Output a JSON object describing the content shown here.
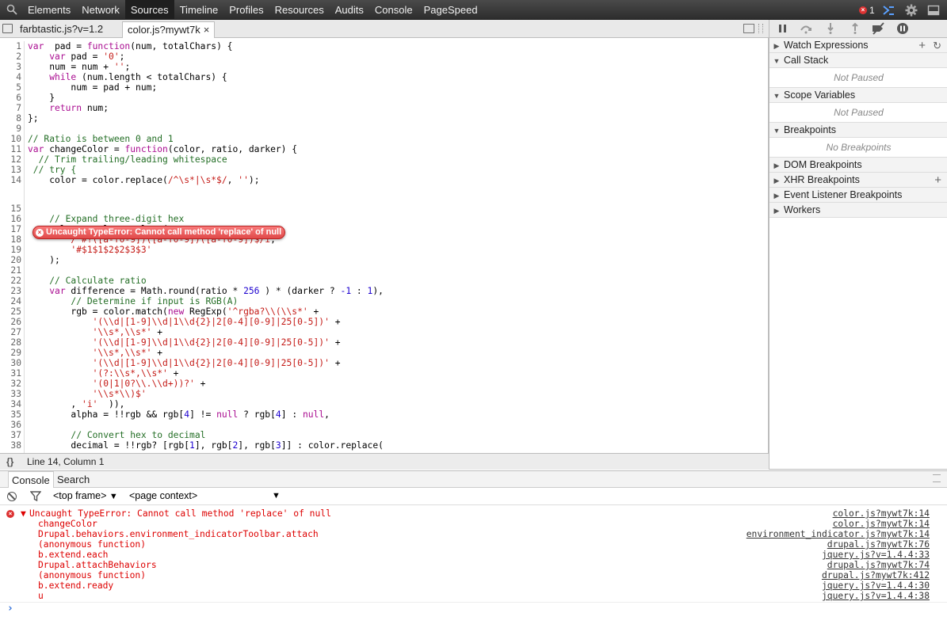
{
  "toolbar": {
    "tabs": [
      "Elements",
      "Network",
      "Sources",
      "Timeline",
      "Profiles",
      "Resources",
      "Audits",
      "Console",
      "PageSpeed"
    ],
    "active_tab": "Sources",
    "error_count": "1",
    "icons": [
      "search-icon",
      "error-icon",
      "drawer-toggle-icon",
      "settings-gear-icon",
      "dock-icon"
    ]
  },
  "file_tabs": {
    "tabs": [
      "farbtastic.js?v=1.2",
      "color.js?mywt7k"
    ],
    "active": "color.js?mywt7k",
    "close_glyph": "×"
  },
  "editor": {
    "lines": [
      {
        "n": "1",
        "segs": [
          [
            "kw",
            "var"
          ],
          [
            "",
            "  pad = "
          ],
          [
            "kw",
            "function"
          ],
          [
            "",
            "(num, totalChars) {"
          ]
        ]
      },
      {
        "n": "2",
        "segs": [
          [
            "",
            "    "
          ],
          [
            "kw",
            "var"
          ],
          [
            "",
            " pad = "
          ],
          [
            "str",
            "'0'"
          ],
          [
            "",
            ";"
          ]
        ]
      },
      {
        "n": "3",
        "segs": [
          [
            "",
            "    num = num + "
          ],
          [
            "str",
            "''"
          ],
          [
            "",
            ";"
          ]
        ]
      },
      {
        "n": "4",
        "segs": [
          [
            "",
            "    "
          ],
          [
            "kw",
            "while"
          ],
          [
            "",
            " (num.length < totalChars) {"
          ]
        ]
      },
      {
        "n": "5",
        "segs": [
          [
            "",
            "        num = pad + num;"
          ]
        ]
      },
      {
        "n": "6",
        "segs": [
          [
            "",
            "    }"
          ]
        ]
      },
      {
        "n": "7",
        "segs": [
          [
            "",
            "    "
          ],
          [
            "kw",
            "return"
          ],
          [
            "",
            " num;"
          ]
        ]
      },
      {
        "n": "8",
        "segs": [
          [
            "",
            "};"
          ]
        ]
      },
      {
        "n": "9",
        "segs": []
      },
      {
        "n": "10",
        "segs": [
          [
            "cmt",
            "// Ratio is between 0 and 1"
          ]
        ]
      },
      {
        "n": "11",
        "segs": [
          [
            "kw",
            "var"
          ],
          [
            "",
            " changeColor = "
          ],
          [
            "kw",
            "function"
          ],
          [
            "",
            "(color, ratio, darker) {"
          ]
        ]
      },
      {
        "n": "12",
        "segs": [
          [
            "",
            "  "
          ],
          [
            "cmt",
            "// Trim trailing/leading whitespace"
          ]
        ]
      },
      {
        "n": "13",
        "segs": [
          [
            "",
            ""
          ],
          [
            "cmt",
            " // try {"
          ]
        ]
      },
      {
        "n": "14",
        "segs": [
          [
            "",
            "    color = color.replace("
          ],
          [
            "str",
            "/^\\s*|\\s*$/"
          ],
          [
            "",
            ", "
          ],
          [
            "str",
            "''"
          ],
          [
            "",
            ");"
          ]
        ]
      },
      {
        "n": "15",
        "segs": []
      },
      {
        "n": "16",
        "segs": [
          [
            "",
            "    "
          ],
          [
            "cmt",
            "// Expand three-digit hex"
          ]
        ]
      },
      {
        "n": "17",
        "segs": [
          [
            "",
            "    color = color.replace("
          ]
        ]
      },
      {
        "n": "18",
        "segs": [
          [
            "",
            "        "
          ],
          [
            "str",
            "/^#?([a-f0-9])([a-f0-9])([a-f0-9])$/i"
          ],
          [
            "",
            ","
          ]
        ]
      },
      {
        "n": "19",
        "segs": [
          [
            "",
            "        "
          ],
          [
            "str",
            "'#$1$1$2$2$3$3'"
          ]
        ]
      },
      {
        "n": "20",
        "segs": [
          [
            "",
            "    );"
          ]
        ]
      },
      {
        "n": "21",
        "segs": []
      },
      {
        "n": "22",
        "segs": [
          [
            "",
            "    "
          ],
          [
            "cmt",
            "// Calculate ratio"
          ]
        ]
      },
      {
        "n": "23",
        "segs": [
          [
            "",
            "    "
          ],
          [
            "kw",
            "var"
          ],
          [
            "",
            " difference = Math.round(ratio * "
          ],
          [
            "num",
            "256"
          ],
          [
            "",
            " ) * (darker ? "
          ],
          [
            "num",
            "-1"
          ],
          [
            "",
            " : "
          ],
          [
            "num",
            "1"
          ],
          [
            "",
            "),"
          ]
        ]
      },
      {
        "n": "24",
        "segs": [
          [
            "",
            "        "
          ],
          [
            "cmt",
            "// Determine if input is RGB(A)"
          ]
        ]
      },
      {
        "n": "25",
        "segs": [
          [
            "",
            "        rgb = color.match("
          ],
          [
            "kw",
            "new"
          ],
          [
            "",
            " RegExp("
          ],
          [
            "str",
            "'^rgba?\\\\(\\\\s*'"
          ],
          [
            "",
            " +"
          ]
        ]
      },
      {
        "n": "26",
        "segs": [
          [
            "",
            "            "
          ],
          [
            "str",
            "'(\\\\d|[1-9]\\\\d|1\\\\d{2}|2[0-4][0-9]|25[0-5])'"
          ],
          [
            "",
            " +"
          ]
        ]
      },
      {
        "n": "27",
        "segs": [
          [
            "",
            "            "
          ],
          [
            "str",
            "'\\\\s*,\\\\s*'"
          ],
          [
            "",
            " +"
          ]
        ]
      },
      {
        "n": "28",
        "segs": [
          [
            "",
            "            "
          ],
          [
            "str",
            "'(\\\\d|[1-9]\\\\d|1\\\\d{2}|2[0-4][0-9]|25[0-5])'"
          ],
          [
            "",
            " +"
          ]
        ]
      },
      {
        "n": "29",
        "segs": [
          [
            "",
            "            "
          ],
          [
            "str",
            "'\\\\s*,\\\\s*'"
          ],
          [
            "",
            " +"
          ]
        ]
      },
      {
        "n": "30",
        "segs": [
          [
            "",
            "            "
          ],
          [
            "str",
            "'(\\\\d|[1-9]\\\\d|1\\\\d{2}|2[0-4][0-9]|25[0-5])'"
          ],
          [
            "",
            " +"
          ]
        ]
      },
      {
        "n": "31",
        "segs": [
          [
            "",
            "            "
          ],
          [
            "str",
            "'(?:\\\\s*,\\\\s*'"
          ],
          [
            "",
            " +"
          ]
        ]
      },
      {
        "n": "32",
        "segs": [
          [
            "",
            "            "
          ],
          [
            "str",
            "'(0|1|0?\\\\.\\\\d+))?'"
          ],
          [
            "",
            " +"
          ]
        ]
      },
      {
        "n": "33",
        "segs": [
          [
            "",
            "            "
          ],
          [
            "str",
            "'\\\\s*\\\\)$'"
          ]
        ]
      },
      {
        "n": "34",
        "segs": [
          [
            "",
            "        , "
          ],
          [
            "str",
            "'i'"
          ],
          [
            "",
            "  )),"
          ]
        ]
      },
      {
        "n": "35",
        "segs": [
          [
            "",
            "        alpha = !!rgb && rgb["
          ],
          [
            "num",
            "4"
          ],
          [
            "",
            "] != "
          ],
          [
            "kw",
            "null"
          ],
          [
            "",
            " ? rgb["
          ],
          [
            "num",
            "4"
          ],
          [
            "",
            "] : "
          ],
          [
            "kw",
            "null"
          ],
          [
            "",
            ","
          ]
        ]
      },
      {
        "n": "36",
        "segs": []
      },
      {
        "n": "37",
        "segs": [
          [
            "",
            "        "
          ],
          [
            "cmt",
            "// Convert hex to decimal"
          ]
        ]
      },
      {
        "n": "38",
        "segs": [
          [
            "",
            "        decimal = !!rgb? [rgb["
          ],
          [
            "num",
            "1"
          ],
          [
            "",
            "], rgb["
          ],
          [
            "num",
            "2"
          ],
          [
            "",
            "], rgb["
          ],
          [
            "num",
            "3"
          ],
          [
            "",
            "]] : color.replace("
          ]
        ]
      }
    ],
    "error_message": "Uncaught TypeError: Cannot call method 'replace' of null"
  },
  "status_bar": {
    "braces": "{}",
    "cursor_position": "Line 14, Column 1"
  },
  "sidebar": {
    "sections": [
      {
        "title": "Watch Expressions",
        "expanded": false
      },
      {
        "title": "Call Stack",
        "expanded": true,
        "info": "Not Paused"
      },
      {
        "title": "Scope Variables",
        "expanded": true,
        "info": "Not Paused"
      },
      {
        "title": "Breakpoints",
        "expanded": true,
        "info": "No Breakpoints"
      },
      {
        "title": "DOM Breakpoints",
        "expanded": false
      },
      {
        "title": "XHR Breakpoints",
        "expanded": false
      },
      {
        "title": "Event Listener Breakpoints",
        "expanded": false
      },
      {
        "title": "Workers",
        "expanded": false
      }
    ],
    "plus_glyph": "+",
    "refresh_glyph": "↻"
  },
  "drawer": {
    "tabs": [
      "Console",
      "Search"
    ],
    "active": "Console",
    "frame_select": "<top frame>",
    "context_select": "<page context>"
  },
  "console": {
    "error_title": "Uncaught TypeError: Cannot call method 'replace' of null",
    "stack": [
      {
        "fn": "changeColor",
        "src": "color.js?mywt7k:14"
      },
      {
        "fn": "Drupal.behaviors.environment_indicatorToolbar.attach",
        "src": "environment_indicator.js?mywt7k:14"
      },
      {
        "fn": "(anonymous function)",
        "src": "drupal.js?mywt7k:76"
      },
      {
        "fn": "b.extend.each",
        "src": "jquery.js?v=1.4.4:33"
      },
      {
        "fn": "Drupal.attachBehaviors",
        "src": "drupal.js?mywt7k:74"
      },
      {
        "fn": "(anonymous function)",
        "src": "drupal.js?mywt7k:412"
      },
      {
        "fn": "b.extend.ready",
        "src": "jquery.js?v=1.4.4:30"
      },
      {
        "fn": "u",
        "src": "jquery.js?v=1.4.4:38"
      }
    ],
    "title_src": "color.js?mywt7k:14",
    "prompt": "›"
  }
}
